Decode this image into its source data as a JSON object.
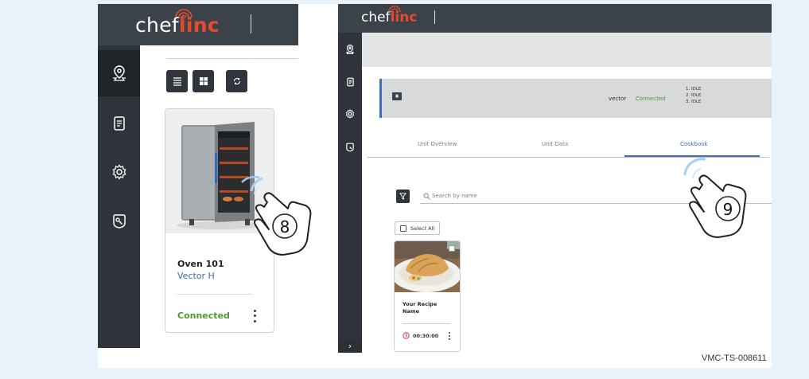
{
  "left_panel": {
    "logo": {
      "prefix": "chef",
      "brand": "linc"
    },
    "nav_items": [
      {
        "name": "map-pin-icon",
        "active": true
      },
      {
        "name": "document-icon",
        "active": false
      },
      {
        "name": "gear-icon",
        "active": false
      },
      {
        "name": "tag-icon",
        "active": false
      }
    ],
    "toolbar": [
      {
        "name": "list-view-icon"
      },
      {
        "name": "grid-view-icon"
      },
      {
        "name": "refresh-icon"
      }
    ],
    "oven_card": {
      "name": "Oven 101",
      "model": "Vector H",
      "status": "Connected",
      "status_color": "#4d9a2d"
    },
    "callout": "⑧"
  },
  "right_panel": {
    "logo": {
      "prefix": "chef",
      "brand": "linc"
    },
    "unit_row": {
      "badge": "▣",
      "name": "vector",
      "connection": "Connected",
      "connection_color": "#45a338",
      "states": [
        "1. IDLE",
        "2. IDLE",
        "3. IDLE"
      ]
    },
    "tabs": [
      {
        "label": "Unit Overview",
        "active": false
      },
      {
        "label": "Unit Data",
        "active": false
      },
      {
        "label": "Cookbook",
        "active": true
      }
    ],
    "search": {
      "placeholder": "Search by name"
    },
    "select_all_label": "Select All",
    "recipe_card": {
      "name": "Your Recipe Name",
      "time": "00:30:00"
    },
    "expand_label": "›",
    "callout": "⑨"
  },
  "doc_id": "VMC-TS-008611",
  "colors": {
    "header": "#3b4249",
    "sidebar": "#2e343a",
    "brand_red": "#e64a2e",
    "accent_blue": "#3a6fc4"
  }
}
